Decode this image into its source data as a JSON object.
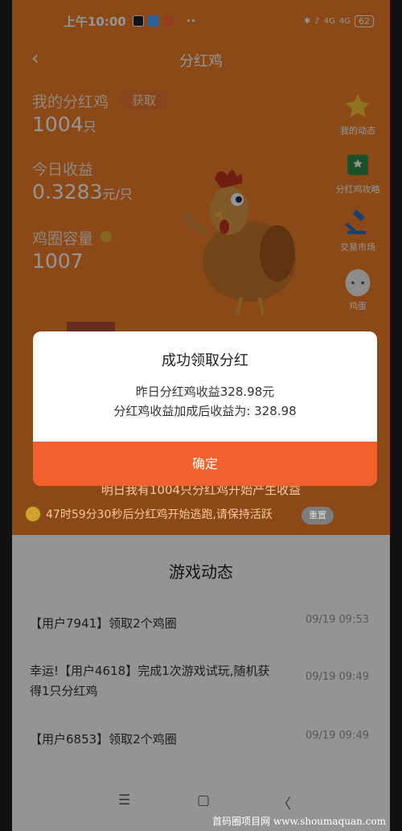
{
  "status_bar": {
    "time": "上午10:00",
    "dots": "··",
    "battery": "62",
    "network_1": "4G",
    "network_2": "4G"
  },
  "nav": {
    "title": "分红鸡"
  },
  "stats": {
    "my_chicken_label": "我的分红鸡",
    "claim_button": "获取",
    "my_chicken_value": "1004",
    "my_chicken_unit": "只",
    "today_income_label": "今日收益",
    "today_income_value": "0.3283",
    "today_income_unit": "元/只",
    "coop_capacity_label": "鸡圈容量",
    "coop_capacity_value": "1007"
  },
  "side_menu": [
    {
      "label": "我的动态",
      "icon": "star-icon"
    },
    {
      "label": "分红鸡攻略",
      "icon": "book-icon"
    },
    {
      "label": "交易市场",
      "icon": "gavel-icon"
    },
    {
      "label": "鸡蛋",
      "icon": "egg-icon"
    }
  ],
  "behind_text": "明日我有1004只分红鸡开始产生收益",
  "countdown": {
    "text": "47时59分30秒后分红鸡开始逃跑,请保持活跃",
    "reset_label": "重置"
  },
  "dialog": {
    "title": "成功领取分红",
    "line1": "昨日分红鸡收益328.98元",
    "line2": "分红鸡收益加成后收益为: 328.98",
    "ok_label": "确定"
  },
  "feed": {
    "title": "游戏动态",
    "rows": [
      {
        "text": "【用户7941】领取2个鸡圈",
        "time": "09/19 09:53"
      },
      {
        "text": "幸运!【用户4618】完成1次游戏试玩,随机获得1只分红鸡",
        "time": "09/19 09:49"
      },
      {
        "text": "【用户6853】领取2个鸡圈",
        "time": "09/19 09:49"
      }
    ]
  },
  "system_nav": {
    "menu": "☰",
    "home": "▢",
    "back": "〈"
  },
  "watermark": "首码圈项目网 www.shoumaquan.com",
  "colors": {
    "orange": "#f07f2a",
    "button_orange": "#f2612b"
  }
}
